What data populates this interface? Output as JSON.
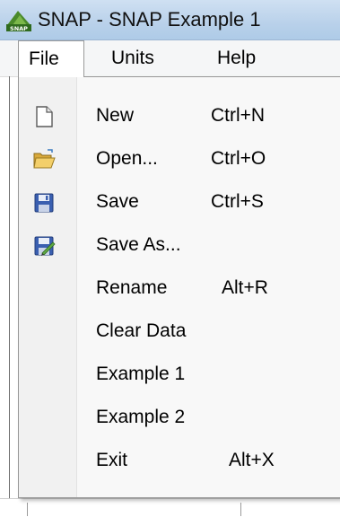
{
  "window": {
    "title": "SNAP - SNAP Example 1",
    "app_icon": "snap-logo-icon"
  },
  "menubar": {
    "items": [
      {
        "label": "File",
        "open": true
      },
      {
        "label": "Units",
        "open": false
      },
      {
        "label": "Help",
        "open": false
      }
    ]
  },
  "file_menu": {
    "items": [
      {
        "label": "New",
        "shortcut": "Ctrl+N",
        "icon": "new-file-icon"
      },
      {
        "label": "Open...",
        "shortcut": "Ctrl+O",
        "icon": "open-folder-icon"
      },
      {
        "label": "Save",
        "shortcut": "Ctrl+S",
        "icon": "save-disk-icon"
      },
      {
        "label": "Save As...",
        "shortcut": "",
        "icon": "save-as-icon"
      },
      {
        "label": "Rename",
        "shortcut": "Alt+R",
        "icon": ""
      },
      {
        "label": "Clear Data",
        "shortcut": "",
        "icon": ""
      },
      {
        "label": "Example 1",
        "shortcut": "",
        "icon": ""
      },
      {
        "label": "Example 2",
        "shortcut": "",
        "icon": ""
      },
      {
        "label": "Exit",
        "shortcut": "Alt+X",
        "icon": ""
      }
    ]
  }
}
